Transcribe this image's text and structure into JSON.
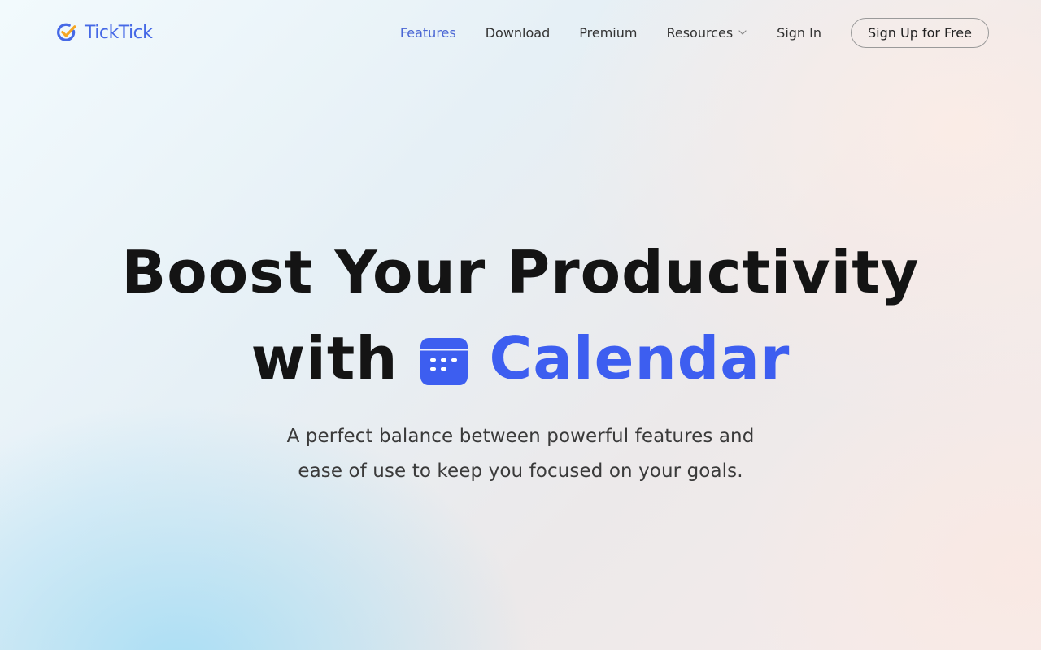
{
  "brand": {
    "name": "TickTick",
    "logo_icon": "ticktick-check-icon",
    "colors": {
      "primary": "#4669e6",
      "check_accent": "#f5a623"
    }
  },
  "nav": {
    "items": [
      {
        "label": "Features",
        "active": true
      },
      {
        "label": "Download",
        "active": false
      },
      {
        "label": "Premium",
        "active": false
      },
      {
        "label": "Resources",
        "active": false,
        "has_dropdown": true
      },
      {
        "label": "Sign In",
        "active": false
      }
    ],
    "cta": "Sign Up for Free"
  },
  "hero": {
    "title_line1": "Boost Your Productivity",
    "title_prefix": "with",
    "title_highlight": "Calendar",
    "highlight_icon": "calendar-icon",
    "highlight_color": "#3d5ef0",
    "subtitle": "A perfect balance between powerful features and ease of use to keep you focused on your goals."
  }
}
